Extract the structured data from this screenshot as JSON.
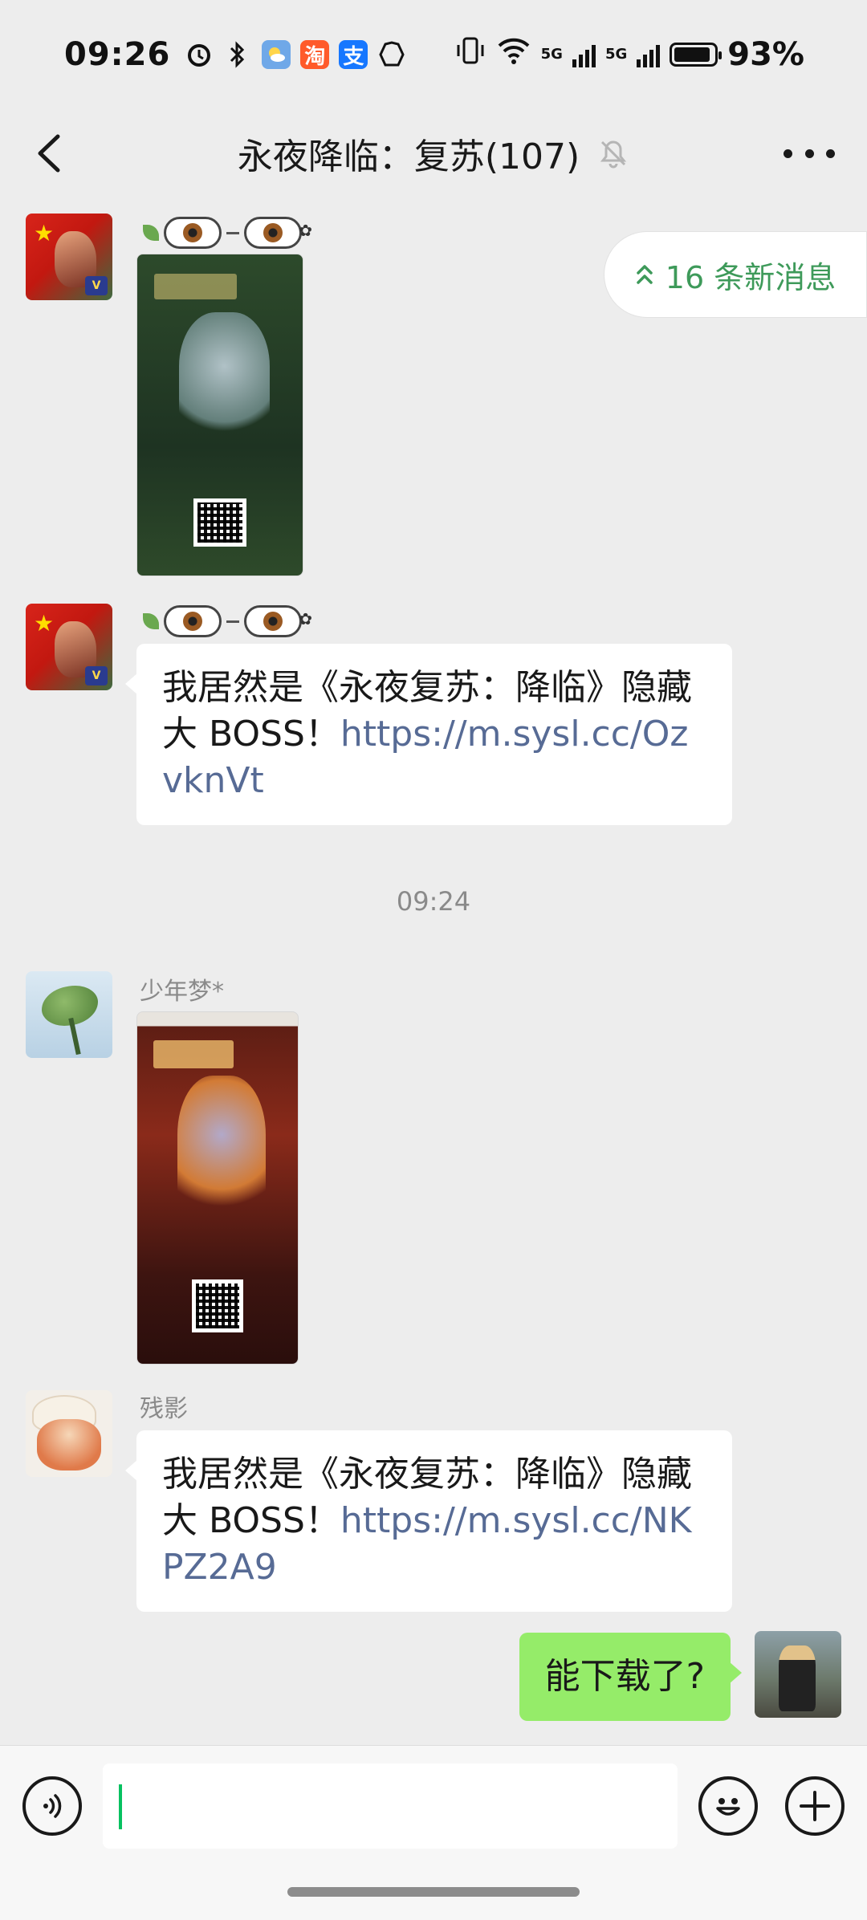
{
  "status_bar": {
    "time": "09:26",
    "left_icons": [
      "alarm-icon",
      "bluetooth-icon",
      "weather-app-icon",
      "taobao-app-icon",
      "alipay-app-icon",
      "gesture-icon"
    ],
    "taobao_glyph": "淘",
    "alipay_glyph": "支",
    "network_label_1": "5G",
    "network_label_2": "5G",
    "battery_percent": "93%"
  },
  "header": {
    "title": "永夜降临：复苏(107)",
    "muted": true
  },
  "new_messages_pill": {
    "label": "16 条新消息"
  },
  "messages": [
    {
      "type": "image",
      "sender": "",
      "sender_has_emoji_name": true,
      "avatar": "flag-avatar"
    },
    {
      "type": "text",
      "sender": "",
      "sender_has_emoji_name": true,
      "avatar": "flag-avatar",
      "text": "我居然是《永夜复苏：降临》隐藏大 BOSS！",
      "link": "https://m.sysl.cc/OzvknVt"
    },
    {
      "type": "timestamp",
      "text": "09:24"
    },
    {
      "type": "image",
      "sender": "少年梦*",
      "avatar": "leaf-avatar"
    },
    {
      "type": "text",
      "sender": "残影",
      "avatar": "anime-avatar",
      "text": "我居然是《永夜复苏：降临》隐藏大 BOSS！",
      "link": "https://m.sysl.cc/NKPZ2A9"
    },
    {
      "type": "text",
      "mine": true,
      "avatar": "me-avatar",
      "text": "能下载了?"
    }
  ],
  "input_bar": {
    "value": "",
    "left_icon": "voice-icon",
    "emoji_icon": "emoji-icon",
    "plus_icon": "plus-icon"
  },
  "colors": {
    "background": "#ededed",
    "bubble_other": "#ffffff",
    "bubble_mine": "#95ec69",
    "link": "#576b95",
    "accent_green": "#07c160"
  }
}
